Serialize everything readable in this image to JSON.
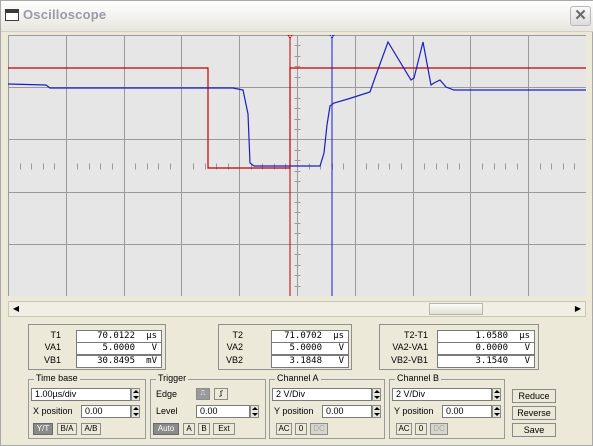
{
  "window": {
    "title": "Oscilloscope",
    "close_symbol": "✕"
  },
  "screen": {
    "grid_color": "#9a9a9a",
    "background": "#e6e6e6",
    "channel_a_color": "#c00000",
    "channel_b_color": "#1c1cc8",
    "cursor1_label": "1",
    "cursor2_label": "2"
  },
  "readout": {
    "left": {
      "row1": {
        "label": "T1",
        "value": "70.0122",
        "unit": "µs"
      },
      "row2": {
        "label": "VA1",
        "value": "5.0000",
        "unit": "V"
      },
      "row3": {
        "label": "VB1",
        "value": "30.8495",
        "unit": "mV"
      }
    },
    "middle": {
      "row1": {
        "label": "T2",
        "value": "71.0702",
        "unit": "µs"
      },
      "row2": {
        "label": "VA2",
        "value": "5.0000",
        "unit": "V"
      },
      "row3": {
        "label": "VB2",
        "value": "3.1848",
        "unit": "V"
      }
    },
    "right": {
      "row1": {
        "label": "T2-T1",
        "value": "1.0580",
        "unit": "µs"
      },
      "row2": {
        "label": "VA2-VA1",
        "value": "0.0000",
        "unit": "V"
      },
      "row3": {
        "label": "VB2-VB1",
        "value": "3.1540",
        "unit": "V"
      }
    }
  },
  "time_base": {
    "title": "Time base",
    "value": "1.00µs/div",
    "x_position_label": "X position",
    "x_position": "0.00",
    "btn_yt": "Y/T",
    "btn_ba": "B/A",
    "btn_ab": "A/B"
  },
  "trigger": {
    "title": "Trigger",
    "edge_label": "Edge",
    "level_label": "Level",
    "level": "0.00",
    "btn_auto": "Auto",
    "btn_a": "A",
    "btn_b": "B",
    "btn_ext": "Ext"
  },
  "channel_a": {
    "title": "Channel A",
    "value": "2 V/Div",
    "y_position_label": "Y position",
    "y_position": "0.00",
    "btn_ac": "AC",
    "btn_0": "0",
    "btn_dc": "DC"
  },
  "channel_b": {
    "title": "Channel B",
    "value": "2 V/Div",
    "y_position_label": "Y position",
    "y_position": "0.00",
    "btn_ac": "AC",
    "btn_0": "0",
    "btn_dc": "DC"
  },
  "actions": {
    "reduce": "Reduce",
    "reverse": "Reverse",
    "save": "Save"
  }
}
